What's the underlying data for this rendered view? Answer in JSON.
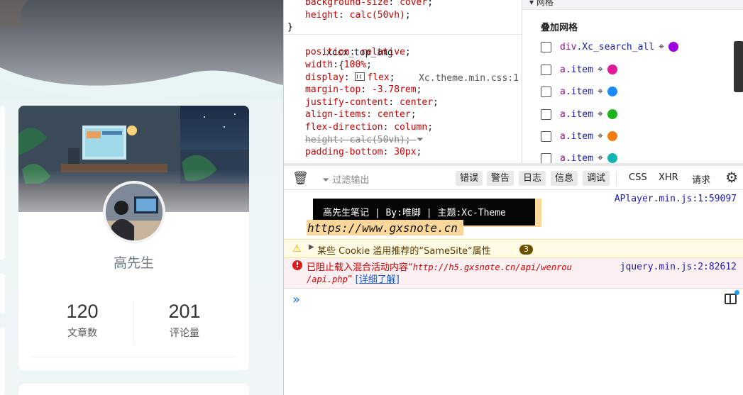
{
  "page": {
    "author_name": "高先生",
    "stats": [
      {
        "value": "120",
        "label": "文章数"
      },
      {
        "value": "201",
        "label": "评论量"
      }
    ]
  },
  "styles_pane": {
    "lines": [
      {
        "prop": "background-size",
        "value": "cover"
      },
      {
        "prop": "height",
        "value": "calc(50vh)"
      }
    ],
    "close_brace": "}",
    "rule_selector": ".xccx_top_img",
    "rule_source": "Xc.theme.min.css:1",
    "open_brace": "{",
    "rule_props": [
      {
        "prop": "position",
        "value": "relative"
      },
      {
        "prop": "width",
        "value": "100%"
      },
      {
        "prop": "display",
        "value": "flex"
      },
      {
        "prop": "margin-top",
        "value": "-3.78rem"
      },
      {
        "prop": "justify-content",
        "value": "center"
      },
      {
        "prop": "align-items",
        "value": "center"
      },
      {
        "prop": "flex-direction",
        "value": "column"
      },
      {
        "prop": "height",
        "value": "calc(50vh)"
      },
      {
        "prop": "padding-bottom",
        "value": "30px"
      }
    ]
  },
  "layout_pane": {
    "header": "网格",
    "overlay_title": "叠加网格",
    "grid_items": [
      {
        "tag": "div",
        "cls": ".Xc_search_all",
        "color": "#a000e0"
      },
      {
        "tag": "a",
        "cls": ".item",
        "color": "#e0189c"
      },
      {
        "tag": "a",
        "cls": ".item",
        "color": "#1a8cff"
      },
      {
        "tag": "a",
        "cls": ".item",
        "color": "#1db41d"
      },
      {
        "tag": "a",
        "cls": ".item",
        "color": "#f07f10"
      },
      {
        "tag": "a",
        "cls": ".item",
        "color": "#14b4b4"
      }
    ]
  },
  "console": {
    "filter_placeholder": "过滤输出",
    "levels": [
      "错误",
      "警告",
      "日志",
      "信息",
      "调试"
    ],
    "types": [
      "CSS",
      "XHR",
      "请求"
    ],
    "styled_log_text": "高先生笔记 | By:唯脚 | 主题:Xc-Theme",
    "styled_log_url": "https://www.gxsnote.cn",
    "styled_log_source": "APlayer.min.js:1:59097",
    "warning_text": "某些 Cookie 滥用推荐的“SameSite“属性",
    "warning_count": "3",
    "error_prefix": "已阻止载入混合活动内容“",
    "error_url_1": "http://h5.gxsnote.cn/api/wenrou",
    "error_url_2": "/api.php",
    "error_suffix": "” ",
    "error_detail": "[详细了解]",
    "error_source": "jquery.min.js:2:82612",
    "prompt": "»"
  }
}
